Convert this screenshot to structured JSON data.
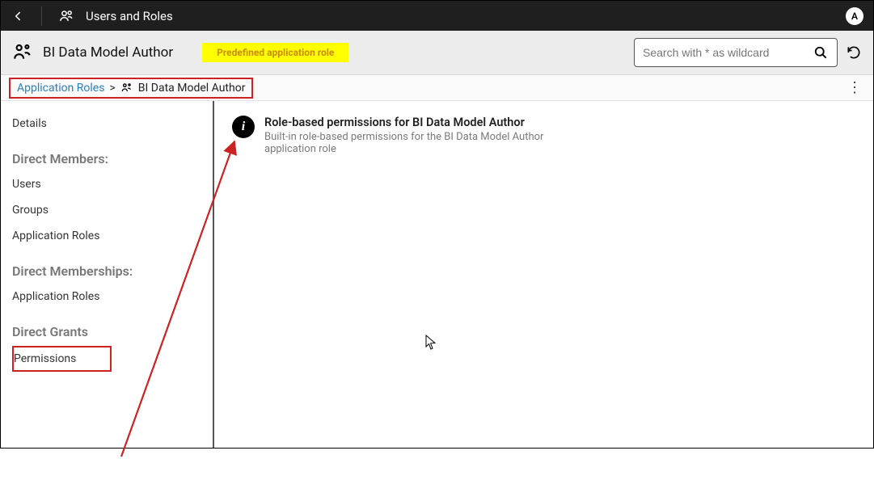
{
  "topbar": {
    "title": "Users and Roles",
    "avatar_letter": "A"
  },
  "subheader": {
    "role_name": "BI Data Model Author",
    "predefined_badge": "Predefined application role",
    "search_placeholder": "Search with * as wildcard"
  },
  "breadcrumb": {
    "root": "Application Roles",
    "separator": ">",
    "current": "BI Data Model Author"
  },
  "sidebar": {
    "details": "Details",
    "section_members": "Direct Members:",
    "users": "Users",
    "groups": "Groups",
    "app_roles": "Application Roles",
    "section_memberships": "Direct Memberships:",
    "app_roles2": "Application Roles",
    "section_grants": "Direct Grants",
    "permissions": "Permissions"
  },
  "content": {
    "perm_title": "Role-based permissions for BI Data Model Author",
    "perm_desc": "Built-in role-based permissions for the BI Data Model Author application role"
  }
}
